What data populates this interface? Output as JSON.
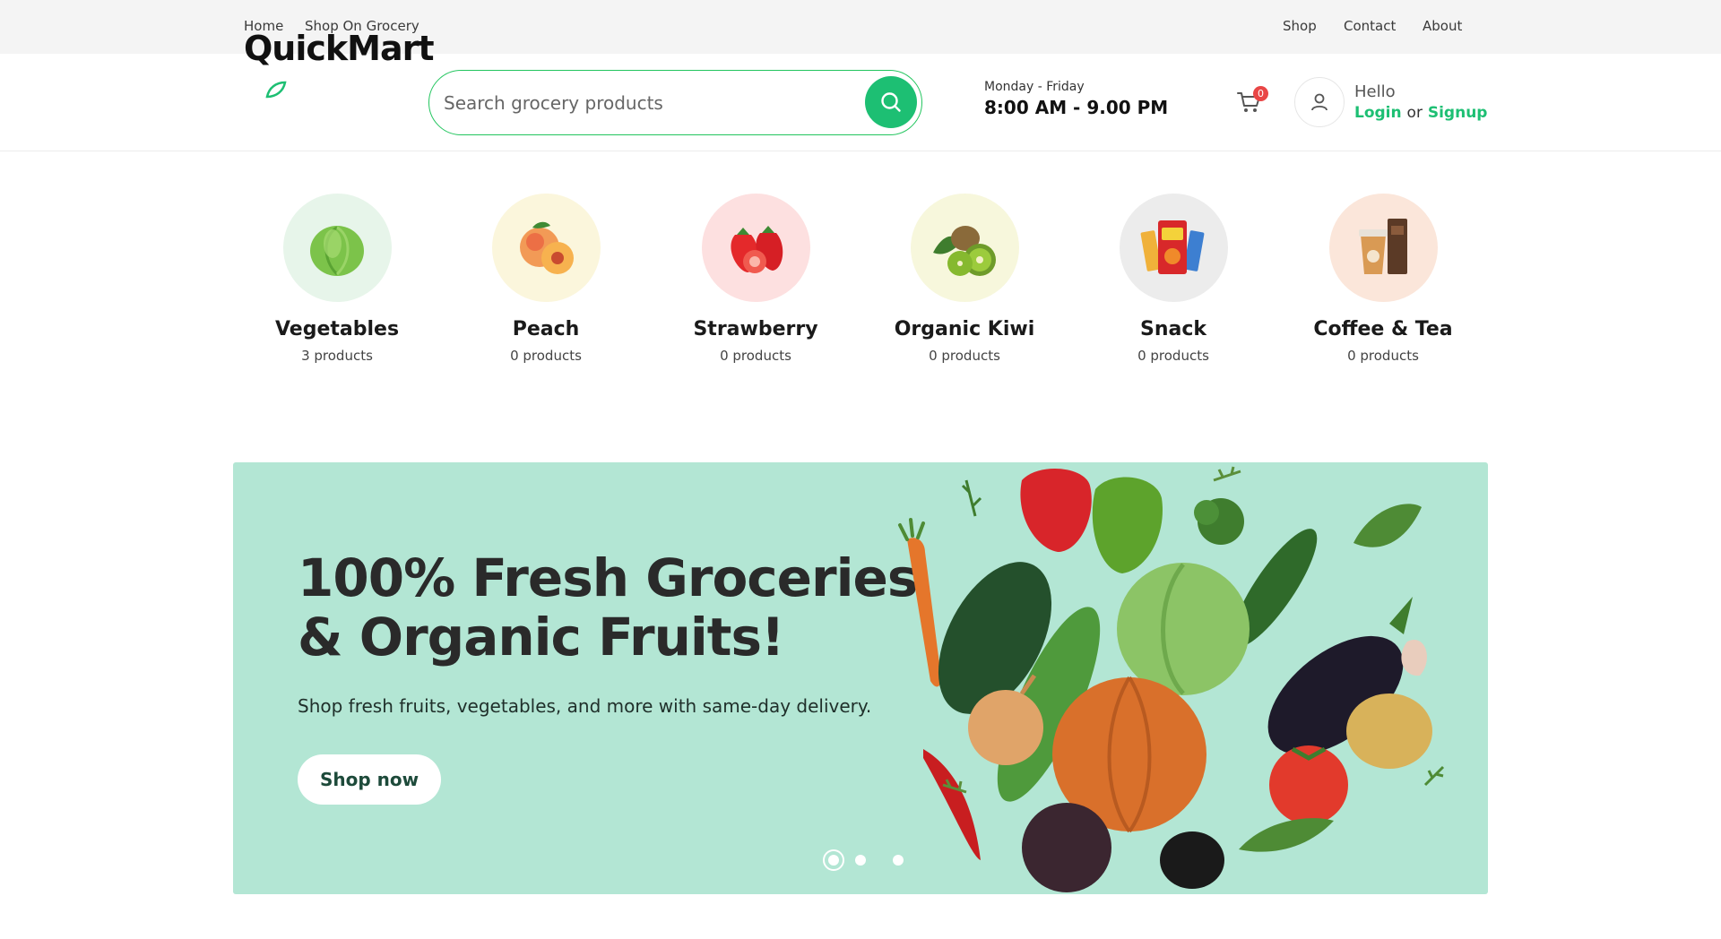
{
  "topnav": {
    "left": [
      "Home",
      "Shop On Grocery"
    ],
    "right": [
      "Shop",
      "Contact",
      "About"
    ]
  },
  "header": {
    "logo": "QuickMart",
    "search_placeholder": "Search grocery products",
    "hours_days": "Monday - Friday",
    "hours_time": "8:00 AM - 9.00 PM",
    "cart_count": "0",
    "hello": "Hello",
    "login": "Login",
    "or": "or",
    "signup": "Signup"
  },
  "categories": [
    {
      "name": "Vegetables",
      "count": "3 products",
      "bg": "#e7f5ea"
    },
    {
      "name": "Peach",
      "count": "0 products",
      "bg": "#fbf6dc"
    },
    {
      "name": "Strawberry",
      "count": "0 products",
      "bg": "#fde0e0"
    },
    {
      "name": "Organic Kiwi",
      "count": "0 products",
      "bg": "#f7f7dc"
    },
    {
      "name": "Snack",
      "count": "0 products",
      "bg": "#ececec"
    },
    {
      "name": "Coffee & Tea",
      "count": "0 products",
      "bg": "#fbe6da"
    }
  ],
  "hero": {
    "title_line1": "100% Fresh Groceries",
    "title_line2": "& Organic Fruits!",
    "subtitle": "Shop fresh fruits, vegetables, and more with same-day delivery.",
    "cta": "Shop now",
    "bg": "#b3e6d4",
    "active_slide": 1,
    "slides_total": 3
  },
  "colors": {
    "accent": "#1dbf73",
    "badge": "#e94646"
  }
}
